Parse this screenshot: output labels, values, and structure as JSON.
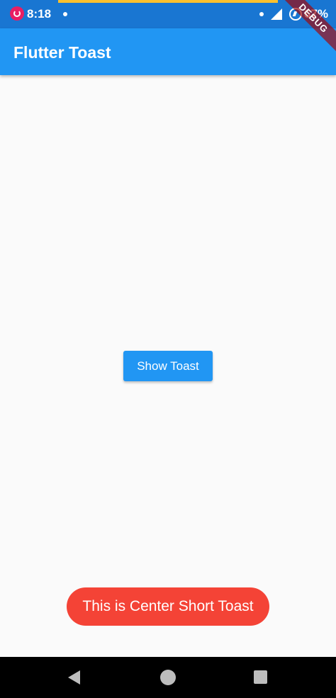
{
  "status_bar": {
    "time": "8:18",
    "battery": "67%"
  },
  "debug_banner": {
    "label": "DEBUG"
  },
  "app_bar": {
    "title": "Flutter Toast"
  },
  "main": {
    "show_toast_label": "Show Toast"
  },
  "toast": {
    "message": "This is Center Short Toast"
  },
  "colors": {
    "status_bar": "#1976d2",
    "app_bar": "#2196f3",
    "button": "#2196f3",
    "toast": "#f44336",
    "background": "#fafafa",
    "nav_bar": "#000000"
  },
  "icons": {
    "status_app": "app-notification-icon",
    "signal": "cell-signal-icon",
    "battery": "battery-saver-icon",
    "nav_back": "back-triangle-icon",
    "nav_home": "home-circle-icon",
    "nav_recents": "recents-square-icon"
  }
}
